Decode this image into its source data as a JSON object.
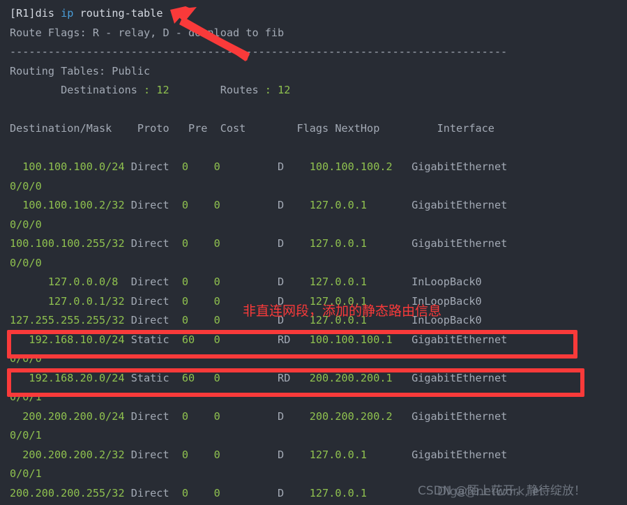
{
  "terminal": {
    "prompt_line": {
      "prompt": "[R1]dis ",
      "keyword": "ip",
      "argument": " routing-table"
    },
    "route_flags": "Route Flags: R - relay, D - download to fib",
    "separator": "------------------------------------------------------------------------------",
    "tables_label": "Routing Tables: Public",
    "summary": {
      "destinations_label": "        Destinations ",
      "destinations_colon": ":",
      "destinations_value": " 12",
      "routes_label": "        Routes ",
      "routes_colon": ":",
      "routes_value": " 12"
    },
    "columns": {
      "header_line": "Destination/Mask    Proto   Pre  Cost        Flags NextHop         Interface",
      "destination": "Destination/Mask",
      "proto": "Proto",
      "pre": "Pre",
      "cost": "Cost",
      "flags": "Flags",
      "nexthop": "NextHop",
      "interface": "Interface"
    },
    "routes": [
      {
        "dest": "  100.100.100.0/24",
        "proto": "Direct",
        "pre": "0",
        "cost": "0",
        "flags": "D",
        "nexthop": "100.100.100.2",
        "iface": "GigabitEthernet",
        "cont": "0/0/0"
      },
      {
        "dest": "  100.100.100.2/32",
        "proto": "Direct",
        "pre": "0",
        "cost": "0",
        "flags": "D",
        "nexthop": "127.0.0.1",
        "iface": "GigabitEthernet",
        "cont": "0/0/0"
      },
      {
        "dest": "100.100.100.255/32",
        "proto": "Direct",
        "pre": "0",
        "cost": "0",
        "flags": "D",
        "nexthop": "127.0.0.1",
        "iface": "GigabitEthernet",
        "cont": "0/0/0"
      },
      {
        "dest": "      127.0.0.0/8",
        "proto": "Direct",
        "pre": "0",
        "cost": "0",
        "flags": "D",
        "nexthop": "127.0.0.1",
        "iface": "InLoopBack0",
        "cont": ""
      },
      {
        "dest": "      127.0.0.1/32",
        "proto": "Direct",
        "pre": "0",
        "cost": "0",
        "flags": "D",
        "nexthop": "127.0.0.1",
        "iface": "InLoopBack0",
        "cont": ""
      },
      {
        "dest": "127.255.255.255/32",
        "proto": "Direct",
        "pre": "0",
        "cost": "0",
        "flags": "D",
        "nexthop": "127.0.0.1",
        "iface": "InLoopBack0",
        "cont": ""
      },
      {
        "dest": "   192.168.10.0/24",
        "proto": "Static",
        "pre": "60",
        "cost": "0",
        "flags": "RD",
        "nexthop": "100.100.100.1",
        "iface": "GigabitEthernet",
        "cont": "0/0/0"
      },
      {
        "dest": "   192.168.20.0/24",
        "proto": "Static",
        "pre": "60",
        "cost": "0",
        "flags": "RD",
        "nexthop": "200.200.200.1",
        "iface": "GigabitEthernet",
        "cont": "0/0/1"
      },
      {
        "dest": "  200.200.200.0/24",
        "proto": "Direct",
        "pre": "0",
        "cost": "0",
        "flags": "D",
        "nexthop": "200.200.200.2",
        "iface": "GigabitEthernet",
        "cont": "0/0/1"
      },
      {
        "dest": "  200.200.200.2/32",
        "proto": "Direct",
        "pre": "0",
        "cost": "0",
        "flags": "D",
        "nexthop": "127.0.0.1",
        "iface": "GigabitEthernet",
        "cont": "0/0/1"
      },
      {
        "dest": "200.200.200.255/32",
        "proto": "Direct",
        "pre": "0",
        "cost": "0",
        "flags": "D",
        "nexthop": "127.0.0.1",
        "iface": "",
        "cont": ""
      }
    ]
  },
  "annotations": {
    "chinese_note": "非直连网段，添加的静态路由信息",
    "arrow": "red-arrow-pointing-to-command",
    "highlight_color": "#f93a3a"
  },
  "watermark": {
    "front": "CSDN @陌上花开，静待绽放！",
    "back": "Dlga@network, et"
  },
  "colors": {
    "background": "#282c34",
    "text": "#b9bfc9",
    "value_green": "#8fc14f",
    "keyword_blue": "#4a9eda",
    "annotation_red": "#f93a3a"
  }
}
